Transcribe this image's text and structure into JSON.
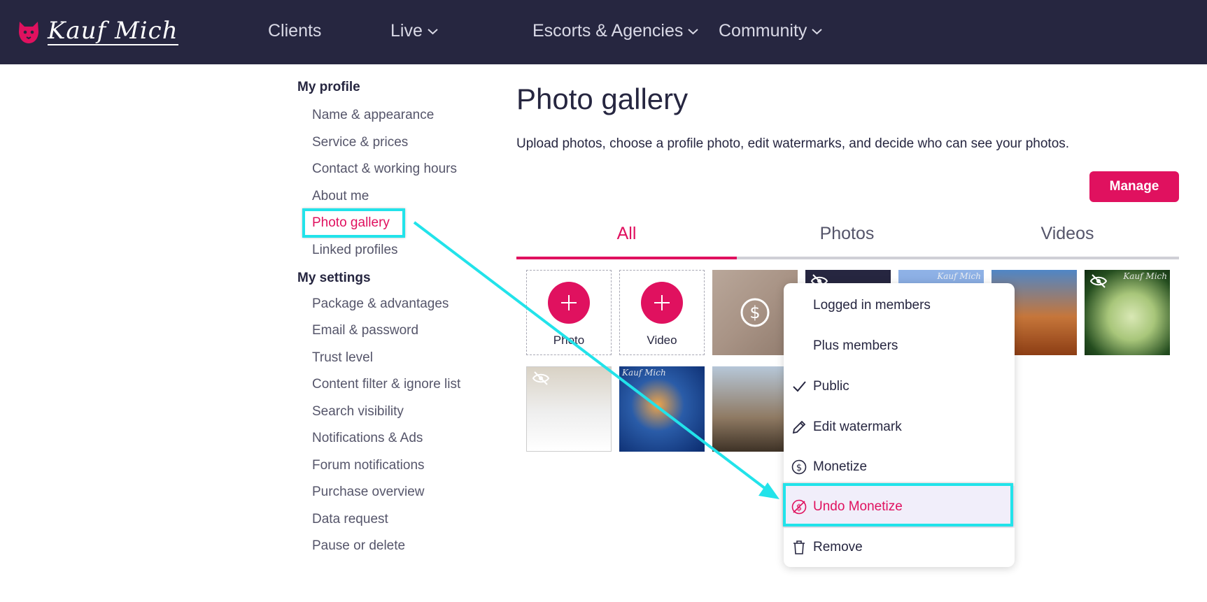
{
  "brand": {
    "name": "Kauf Mich"
  },
  "nav": [
    {
      "label": "Clients",
      "dropdown": false
    },
    {
      "label": "Live",
      "dropdown": true
    },
    {
      "label": "Escorts & Agencies",
      "dropdown": true
    },
    {
      "label": "Community",
      "dropdown": true
    }
  ],
  "sidebar": {
    "sections": [
      {
        "heading": "My profile",
        "items": [
          "Name & appearance",
          "Service & prices",
          "Contact & working hours",
          "About me",
          "Photo gallery",
          "Linked profiles"
        ]
      },
      {
        "heading": "My settings",
        "items": [
          "Package & advantages",
          "Email & password",
          "Trust level",
          "Content filter & ignore list",
          "Search visibility",
          "Notifications & Ads",
          "Forum notifications",
          "Purchase overview",
          "Data request",
          "Pause or delete"
        ]
      }
    ],
    "active_item": "Photo gallery"
  },
  "main": {
    "title": "Photo gallery",
    "description": "Upload photos, choose a profile photo, edit watermarks, and decide who can see your photos.",
    "manage_label": "Manage",
    "tabs": [
      {
        "label": "All"
      },
      {
        "label": "Photos"
      },
      {
        "label": "Videos"
      }
    ],
    "active_tab": "All",
    "upload": {
      "photo_label": "Photo",
      "video_label": "Video"
    },
    "watermark_text": "Kauf Mich"
  },
  "context_menu": {
    "items": [
      {
        "label": "Logged in members",
        "icon": "none"
      },
      {
        "label": "Plus members",
        "icon": "none"
      },
      {
        "label": "Public",
        "icon": "check-icon"
      },
      {
        "label": "Edit watermark",
        "icon": "pencil-icon"
      },
      {
        "label": "Monetize",
        "icon": "dollar-coin-icon"
      },
      {
        "label": "Undo Monetize",
        "icon": "dollar-off-icon"
      },
      {
        "label": "Remove",
        "icon": "trash-icon"
      }
    ],
    "highlighted": "Undo Monetize"
  },
  "colors": {
    "accent": "#e0115f",
    "nav_bg": "#262640",
    "highlight": "#22e3ea"
  }
}
